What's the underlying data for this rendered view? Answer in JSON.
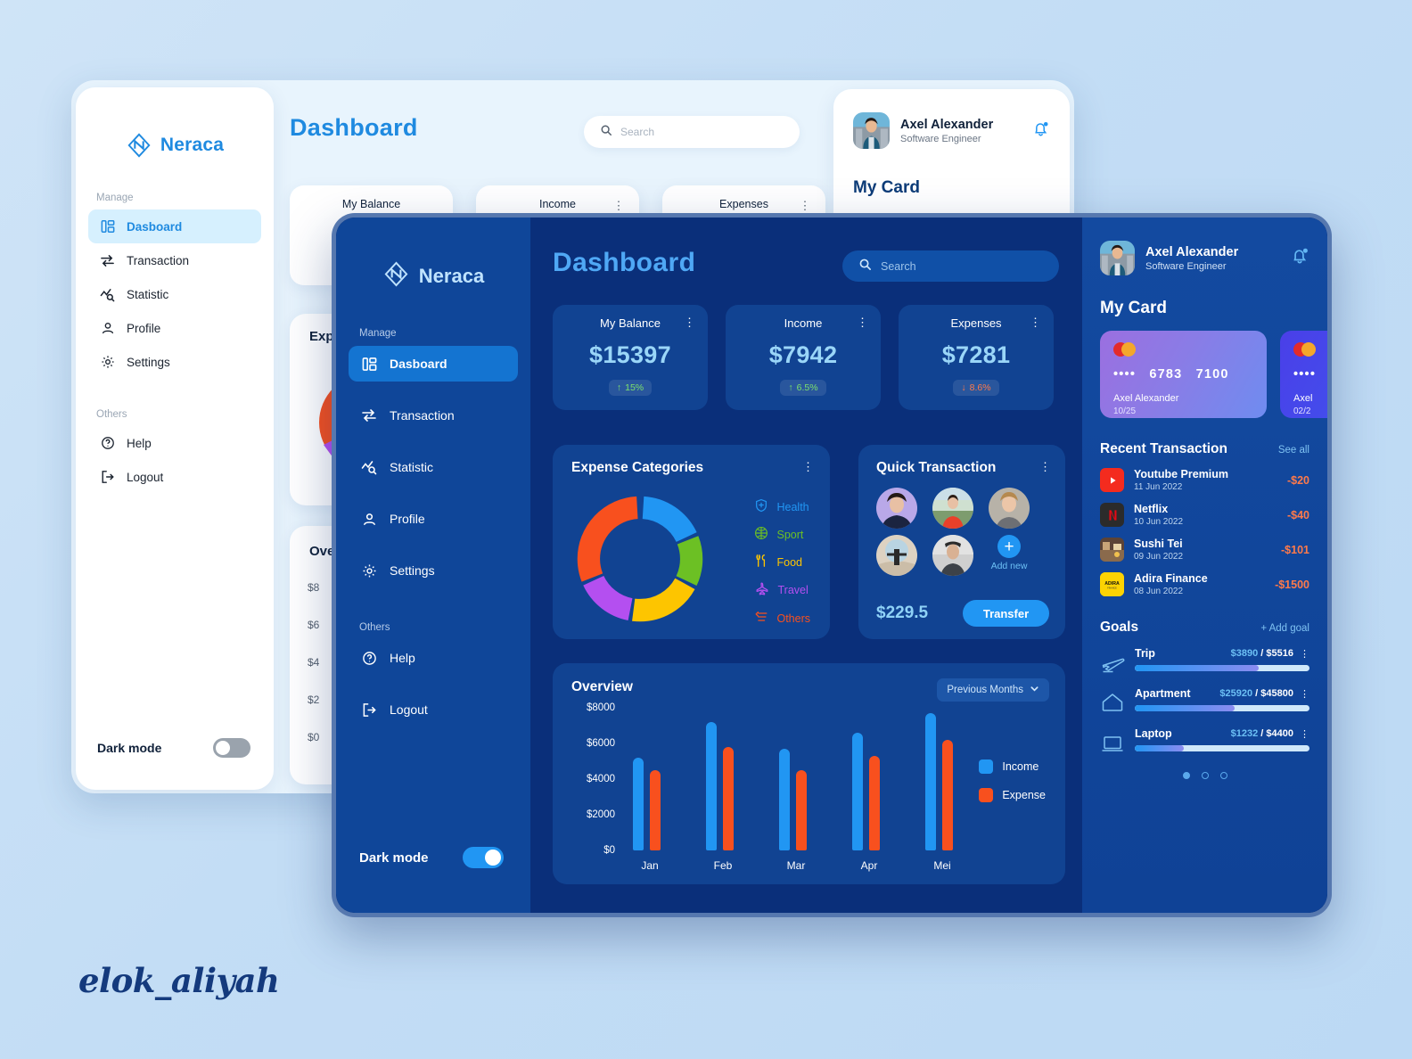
{
  "brand": {
    "name": "Neraca"
  },
  "light_window": {
    "title": "Dashboard",
    "search_placeholder": "Search",
    "sidebar": {
      "manage_label": "Manage",
      "others_label": "Others",
      "items": [
        {
          "label": "Dasboard",
          "icon": "dashboard-icon",
          "active": true
        },
        {
          "label": "Transaction",
          "icon": "transfer-icon",
          "active": false
        },
        {
          "label": "Statistic",
          "icon": "statistic-icon",
          "active": false
        },
        {
          "label": "Profile",
          "icon": "person-icon",
          "active": false
        },
        {
          "label": "Settings",
          "icon": "gear-icon",
          "active": false
        }
      ],
      "other_items": [
        {
          "label": "Help",
          "icon": "help-icon"
        },
        {
          "label": "Logout",
          "icon": "logout-icon"
        }
      ],
      "dark_mode_label": "Dark mode",
      "dark_mode_on": false
    },
    "stat_cards": [
      {
        "label": "My Balance"
      },
      {
        "label": "Income"
      },
      {
        "label": "Expenses"
      }
    ],
    "expense_panel_title": "Exp",
    "overview_panel_title": "Ove",
    "overview_y": [
      "$8",
      "$6",
      "$4",
      "$2",
      "$0"
    ],
    "profile": {
      "name": "Axel Alexander",
      "role": "Software Engineer",
      "my_card_label": "My Card"
    }
  },
  "dark_window": {
    "title": "Dashboard",
    "search_placeholder": "Search",
    "sidebar": {
      "manage_label": "Manage",
      "others_label": "Others",
      "items": [
        {
          "label": "Dasboard",
          "icon": "dashboard-icon",
          "active": true
        },
        {
          "label": "Transaction",
          "icon": "transfer-icon",
          "active": false
        },
        {
          "label": "Statistic",
          "icon": "statistic-icon",
          "active": false
        },
        {
          "label": "Profile",
          "icon": "person-icon",
          "active": false
        },
        {
          "label": "Settings",
          "icon": "gear-icon",
          "active": false
        }
      ],
      "other_items": [
        {
          "label": "Help",
          "icon": "help-icon"
        },
        {
          "label": "Logout",
          "icon": "logout-icon"
        }
      ],
      "dark_mode_label": "Dark mode",
      "dark_mode_on": true
    },
    "stat_cards": [
      {
        "label": "My Balance",
        "value": "$15397",
        "delta": "15%",
        "direction": "up"
      },
      {
        "label": "Income",
        "value": "$7942",
        "delta": "6.5%",
        "direction": "up"
      },
      {
        "label": "Expenses",
        "value": "$7281",
        "delta": "8.6%",
        "direction": "down"
      }
    ],
    "expense_categories": {
      "title": "Expense Categories",
      "legend": [
        {
          "label": "Health",
          "color": "#2196f3",
          "icon": "shield-plus-icon"
        },
        {
          "label": "Sport",
          "color": "#6cc024",
          "icon": "basketball-icon"
        },
        {
          "label": "Food",
          "color": "#fdc500",
          "icon": "cutlery-icon"
        },
        {
          "label": "Travel",
          "color": "#b44ff0",
          "icon": "airplane-icon"
        },
        {
          "label": "Others",
          "color": "#f8501e",
          "icon": "list-icon"
        }
      ]
    },
    "quick_transaction": {
      "title": "Quick Transaction",
      "add_new_label": "Add new",
      "amount": "$229.5",
      "transfer_label": "Transfer",
      "contacts": [
        "contact-1",
        "contact-2",
        "contact-3",
        "contact-4",
        "contact-5"
      ]
    },
    "overview": {
      "title": "Overview",
      "period_label": "Previous Months"
    },
    "right_panel": {
      "name": "Axel Alexander",
      "role": "Software Engineer",
      "my_card_label": "My Card",
      "cards": [
        {
          "network": "mastercard",
          "masked": "••••",
          "g1": "6783",
          "g2": "7100",
          "holder": "Axel Alexander",
          "expiry": "10/25"
        },
        {
          "network": "mastercard",
          "masked": "••••",
          "g1": "",
          "g2": "",
          "holder": "Axel",
          "expiry": "02/2"
        }
      ],
      "recent_title": "Recent Transaction",
      "see_all_label": "See all",
      "transactions": [
        {
          "name": "Youtube Premium",
          "date": "11 Jun 2022",
          "amount": "-$20",
          "icon": "youtube-icon"
        },
        {
          "name": "Netflix",
          "date": "10 Jun 2022",
          "amount": "-$40",
          "icon": "netflix-icon"
        },
        {
          "name": "Sushi Tei",
          "date": "09 Jun 2022",
          "amount": "-$101",
          "icon": "restaurant-icon"
        },
        {
          "name": "Adira Finance",
          "date": "08 Jun 2022",
          "amount": "-$1500",
          "icon": "adira-icon"
        }
      ],
      "goals_title": "Goals",
      "add_goal_label": "+ Add goal",
      "goals": [
        {
          "name": "Trip",
          "current": "$3890",
          "target": "$5516",
          "percent": 71,
          "icon": "airplane-icon"
        },
        {
          "name": "Apartment",
          "current": "$25920",
          "target": "$45800",
          "percent": 57,
          "icon": "house-icon"
        },
        {
          "name": "Laptop",
          "current": "$1232",
          "target": "$4400",
          "percent": 28,
          "icon": "laptop-icon"
        }
      ],
      "carousel_dots": 3,
      "carousel_active": 0
    }
  },
  "watermark": "elok_aliyah",
  "colors": {
    "accent": "#2196f3",
    "dark_bg": "#0a2f7a",
    "sidebar_bg": "#0f4699",
    "panel_bg": "#114392",
    "income": "#2196f3",
    "expense": "#f8501e",
    "positive": "#7de06c",
    "negative": "#ff7a4a"
  },
  "chart_data": [
    {
      "type": "bar",
      "title": "Overview",
      "categories": [
        "Jan",
        "Feb",
        "Mar",
        "Apr",
        "Mei"
      ],
      "series": [
        {
          "name": "Income",
          "color": "#2196f3",
          "values": [
            5200,
            7200,
            5700,
            6600,
            7700
          ]
        },
        {
          "name": "Expense",
          "color": "#f8501e",
          "values": [
            4500,
            5800,
            4500,
            5300,
            6200
          ]
        }
      ],
      "ylabel": "",
      "xlabel": "",
      "ylim": [
        0,
        8000
      ],
      "yticks": [
        0,
        2000,
        4000,
        6000,
        8000
      ],
      "ytick_labels": [
        "$0",
        "$2000",
        "$4000",
        "$6000",
        "$8000"
      ],
      "grid": false,
      "legend_position": "right"
    },
    {
      "type": "pie",
      "title": "Expense Categories",
      "donut": true,
      "labels": [
        "Health",
        "Sport",
        "Food",
        "Travel",
        "Others"
      ],
      "values": [
        18,
        14,
        20,
        16,
        32
      ],
      "colors": [
        "#2196f3",
        "#6cc024",
        "#fdc500",
        "#b44ff0",
        "#f8501e"
      ],
      "legend_position": "right"
    }
  ]
}
